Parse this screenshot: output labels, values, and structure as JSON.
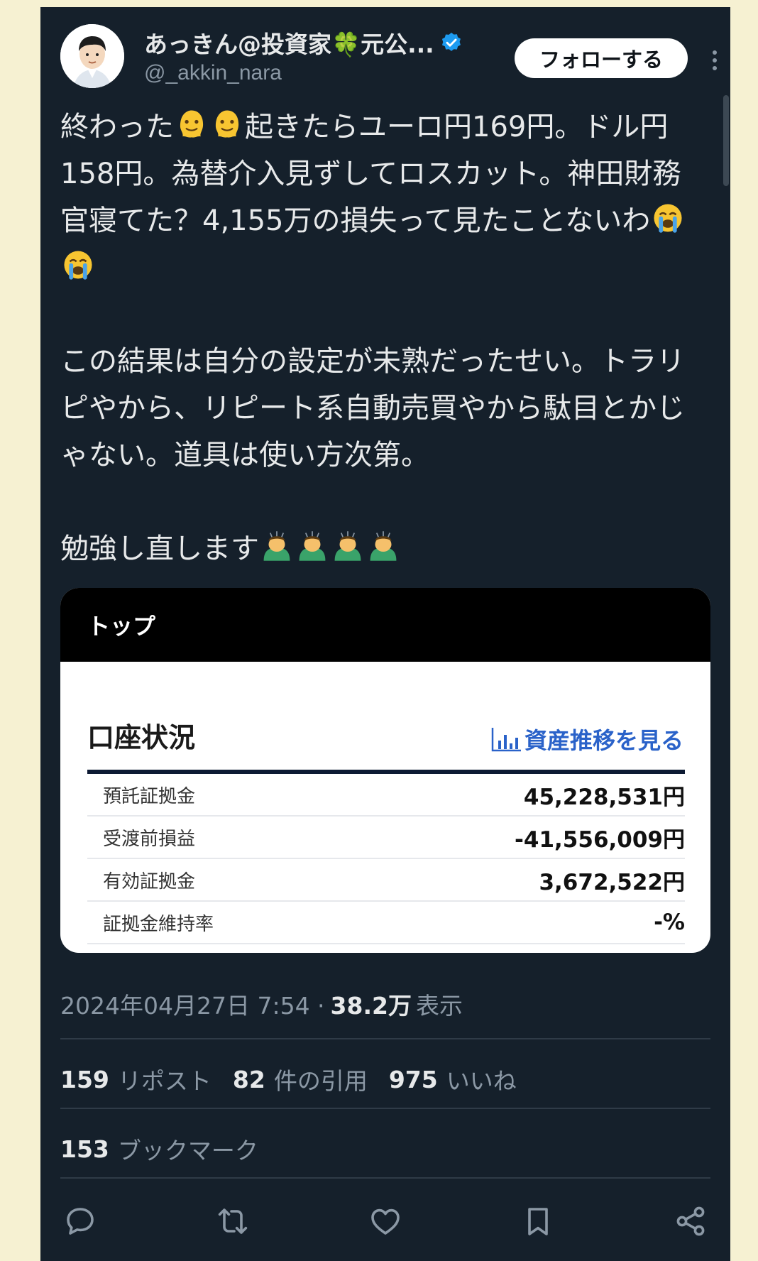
{
  "author": {
    "display_name": "あっきん@投資家🍀元公...",
    "handle": "@_akkin_nara",
    "follow_label": "フォローする"
  },
  "tweet": {
    "line1_a": "終わった",
    "line1_b": "起きたらユーロ円169円。ドル円158円。為替介入見ずしてロスカット。神田財務官寝てた？4,155万の損失って見たことないわ",
    "para2": "この結果は自分の設定が未熟だったせい。トラリピやから、リピート系自動売買やから駄目とかじゃない。道具は使い方次第。",
    "para3": "勉強し直します"
  },
  "card": {
    "top_label": "トップ",
    "section_title": "口座状況",
    "history_link": "資産推移を見る",
    "rows": [
      {
        "label": "預託証拠金",
        "value": "45,228,531円"
      },
      {
        "label": "受渡前損益",
        "value": "-41,556,009円"
      },
      {
        "label": "有効証拠金",
        "value": "3,672,522円"
      },
      {
        "label": "証拠金維持率",
        "value": "-%"
      }
    ]
  },
  "meta": {
    "datetime": "2024年04月27日 7:54 ·",
    "views": "38.2万",
    "views_label": "表示"
  },
  "stats": {
    "reposts": "159",
    "reposts_label": "リポスト",
    "quotes": "82",
    "quotes_label": "件の引用",
    "likes": "975",
    "likes_label": "いいね",
    "bookmarks": "153",
    "bookmarks_label": "ブックマーク"
  },
  "colors": {
    "background": "#15202b",
    "page_margin": "#f6f1d2",
    "accent_link": "#2a62c9",
    "verified": "#1d9bf0"
  },
  "icons": [
    "verified-badge-icon",
    "more-icon",
    "melting-face-emoji",
    "crying-face-emoji",
    "bowing-person-emoji",
    "bar-chart-icon",
    "reply-icon",
    "repost-icon",
    "like-icon",
    "bookmark-icon",
    "share-icon"
  ]
}
